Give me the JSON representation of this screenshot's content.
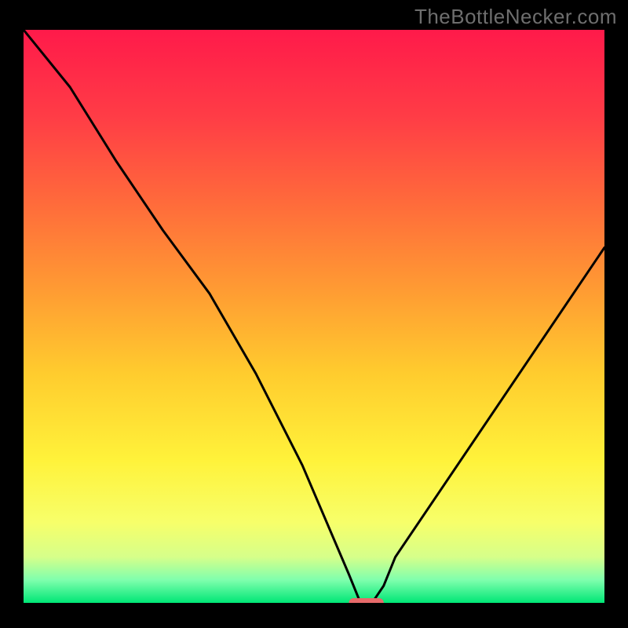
{
  "watermark": "TheBottleNecker.com",
  "chart_data": {
    "type": "line",
    "title": null,
    "xlabel": null,
    "ylabel": null,
    "yaxis": "bottleneck_percent",
    "xlim": [
      0,
      100
    ],
    "ylim": [
      0,
      100
    ],
    "x": [
      0,
      8,
      16,
      24,
      32,
      40,
      48,
      56,
      58,
      60,
      62,
      64,
      100
    ],
    "y": [
      100,
      90,
      77,
      65,
      54,
      40,
      24,
      5,
      0,
      0,
      3,
      8,
      62
    ],
    "marker": {
      "x_range": [
        56,
        62
      ],
      "y": 0,
      "color": "#e76a6a"
    },
    "background": {
      "gradient_stops": [
        {
          "offset": 0.0,
          "color": "#ff1a4a"
        },
        {
          "offset": 0.15,
          "color": "#ff3c46"
        },
        {
          "offset": 0.3,
          "color": "#ff6a3b"
        },
        {
          "offset": 0.45,
          "color": "#ff9a33"
        },
        {
          "offset": 0.6,
          "color": "#ffcc2e"
        },
        {
          "offset": 0.75,
          "color": "#fff23a"
        },
        {
          "offset": 0.86,
          "color": "#f7ff6a"
        },
        {
          "offset": 0.92,
          "color": "#d6ff8a"
        },
        {
          "offset": 0.96,
          "color": "#7fffad"
        },
        {
          "offset": 1.0,
          "color": "#00e676"
        }
      ]
    }
  }
}
